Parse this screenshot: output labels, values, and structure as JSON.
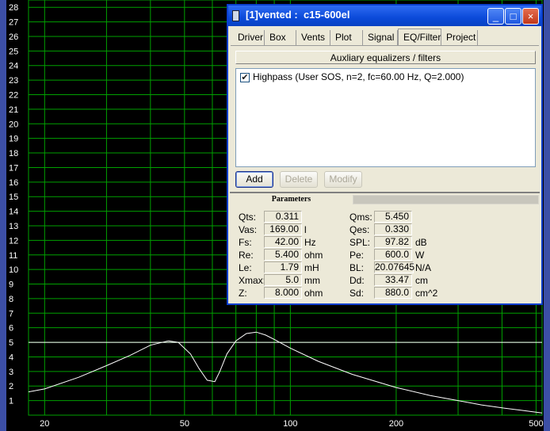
{
  "window": {
    "title": "[1]vented :  c15-600el",
    "colors": {
      "titlebar": "#0b4ad9",
      "plot_bg": "#000000",
      "grid": "#00a000",
      "axis_frame": "#3c4fa6"
    }
  },
  "tabs": [
    {
      "label": "Driver",
      "active": false
    },
    {
      "label": "Box",
      "active": false
    },
    {
      "label": "Vents",
      "active": false
    },
    {
      "label": "Plot",
      "active": false
    },
    {
      "label": "Signal",
      "active": false
    },
    {
      "label": "EQ/Filter",
      "active": true
    },
    {
      "label": "Project",
      "active": false
    }
  ],
  "eq": {
    "header": "Auxliary equalizers / filters",
    "items": [
      {
        "checked": true,
        "label": "Highpass (User SOS, n=2, fc=60.00 Hz, Q=2.000)"
      }
    ],
    "buttons": {
      "add": "Add",
      "delete": "Delete",
      "modify": "Modify"
    }
  },
  "params": {
    "heading": "Parameters",
    "left": [
      {
        "label": "Qts:",
        "value": "0.311",
        "unit": ""
      },
      {
        "label": "Vas:",
        "value": "169.00",
        "unit": "l"
      },
      {
        "label": "Fs:",
        "value": "42.00",
        "unit": "Hz"
      },
      {
        "label": "Re:",
        "value": "5.400",
        "unit": "ohm"
      },
      {
        "label": "Le:",
        "value": "1.79",
        "unit": "mH"
      },
      {
        "label": "Xmax:",
        "value": "5.0",
        "unit": "mm"
      },
      {
        "label": "Z:",
        "value": "8.000",
        "unit": "ohm"
      }
    ],
    "right": [
      {
        "label": "Qms:",
        "value": "5.450",
        "unit": ""
      },
      {
        "label": "Qes:",
        "value": "0.330",
        "unit": ""
      },
      {
        "label": "SPL:",
        "value": "97.82",
        "unit": "dB"
      },
      {
        "label": "Pe:",
        "value": "600.0",
        "unit": "W"
      },
      {
        "label": "BL:",
        "value": "20.07645",
        "unit": "N/A"
      },
      {
        "label": "Dd:",
        "value": "33.47",
        "unit": "cm"
      },
      {
        "label": "Sd:",
        "value": "880.0",
        "unit": "cm^2"
      }
    ]
  },
  "chart_data": {
    "type": "line",
    "x_scale": "log",
    "xlim": [
      18,
      520
    ],
    "ylim": [
      0,
      28.5
    ],
    "y_ticks": [
      1,
      2,
      3,
      4,
      5,
      6,
      7,
      8,
      9,
      10,
      11,
      12,
      13,
      14,
      15,
      16,
      17,
      18,
      19,
      20,
      21,
      22,
      23,
      24,
      25,
      26,
      27,
      28
    ],
    "x_ticks": [
      {
        "value": 20,
        "label": "20"
      },
      {
        "value": 50,
        "label": "50"
      },
      {
        "value": 100,
        "label": "100"
      },
      {
        "value": 200,
        "label": "200"
      },
      {
        "value": 500,
        "label": "500"
      }
    ],
    "x_grid": [
      20,
      30,
      40,
      50,
      60,
      70,
      80,
      90,
      100,
      200,
      300,
      400,
      500
    ],
    "grid": true,
    "reference_line": 5,
    "series": [
      {
        "color": "#ffffff",
        "x": [
          18,
          20,
          25,
          30,
          35,
          40,
          45,
          48,
          52,
          55,
          58,
          61,
          63,
          66,
          70,
          75,
          80,
          85,
          90,
          100,
          120,
          150,
          200,
          250,
          300,
          350,
          400,
          450,
          500,
          520
        ],
        "y": [
          1.6,
          1.8,
          2.6,
          3.4,
          4.1,
          4.8,
          5.1,
          5.0,
          4.2,
          3.2,
          2.4,
          2.3,
          3.0,
          4.2,
          5.1,
          5.6,
          5.7,
          5.5,
          5.2,
          4.6,
          3.7,
          2.8,
          1.9,
          1.35,
          1.0,
          0.7,
          0.5,
          0.35,
          0.2,
          0.15
        ]
      }
    ]
  }
}
